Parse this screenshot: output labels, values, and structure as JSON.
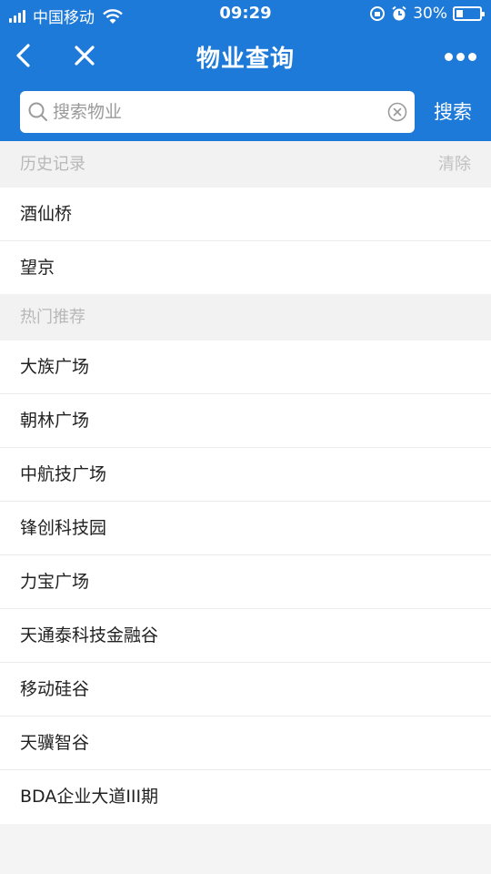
{
  "status_bar": {
    "carrier": "中国移动",
    "time": "09:29",
    "battery": "30%",
    "battery_level": 0.3
  },
  "nav": {
    "title": "物业查询",
    "back_icon": "chevron-left-icon",
    "close_icon": "close-icon",
    "more_icon": "more-dots-icon"
  },
  "search": {
    "placeholder": "搜索物业",
    "value": "",
    "button_label": "搜索"
  },
  "history": {
    "title": "历史记录",
    "clear_label": "清除",
    "items": [
      "酒仙桥",
      "望京"
    ]
  },
  "hot": {
    "title": "热门推荐",
    "items": [
      "大族广场",
      "朝林广场",
      "中航技广场",
      "锋创科技园",
      "力宝广场",
      "天通泰科技金融谷",
      "移动硅谷",
      "天骥智谷",
      "BDA企业大道III期"
    ]
  },
  "colors": {
    "primary": "#1e7ad8",
    "section_bg": "#f2f2f2",
    "section_text": "#b8b8b8",
    "item_text": "#222222"
  }
}
